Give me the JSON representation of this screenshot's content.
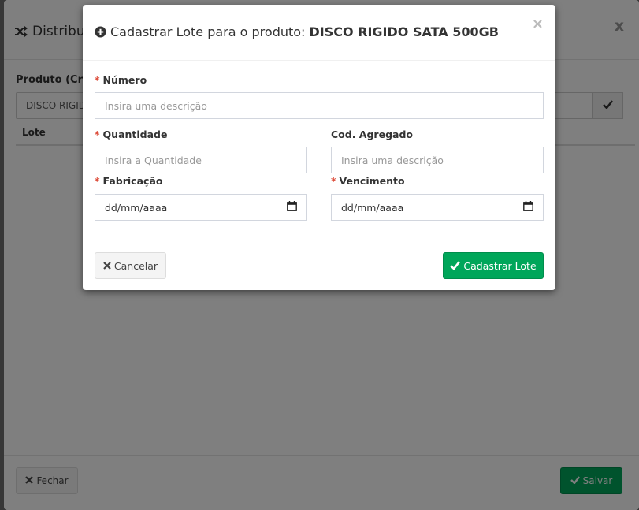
{
  "background_modal": {
    "title": "Distribui",
    "product_label": "Produto (Cria",
    "product_value": "DISCO RIGID",
    "table_header_lote": "Lote",
    "fechar_label": "Fechar",
    "salvar_label": "Salvar"
  },
  "modal": {
    "title_prefix": "Cadastrar Lote para o produto:",
    "product_name": "DISCO RIGIDO SATA 500GB",
    "close_symbol": "×",
    "fields": {
      "numero": {
        "label": "Número",
        "required_mark": "*",
        "placeholder": "Insira uma descrição"
      },
      "quantidade": {
        "label": "Quantidade",
        "required_mark": "*",
        "placeholder": "Insira a Quantidade"
      },
      "cod_agregado": {
        "label": "Cod. Agregado",
        "placeholder": "Insira uma descrição"
      },
      "fabricacao": {
        "label": "Fabricação",
        "required_mark": "*",
        "value": "dd/mm/aaaa"
      },
      "vencimento": {
        "label": "Vencimento",
        "required_mark": "*",
        "value": "dd/mm/aaaa"
      }
    },
    "cancel_label": "Cancelar",
    "submit_label": "Cadastrar Lote"
  },
  "colors": {
    "success": "#00a65a",
    "required": "#dd4b39"
  },
  "icons": {
    "title": "plus-circle-icon",
    "background_title": "random-icon",
    "cancel": "times-icon",
    "submit": "check-icon",
    "calendar": "calendar-icon"
  }
}
